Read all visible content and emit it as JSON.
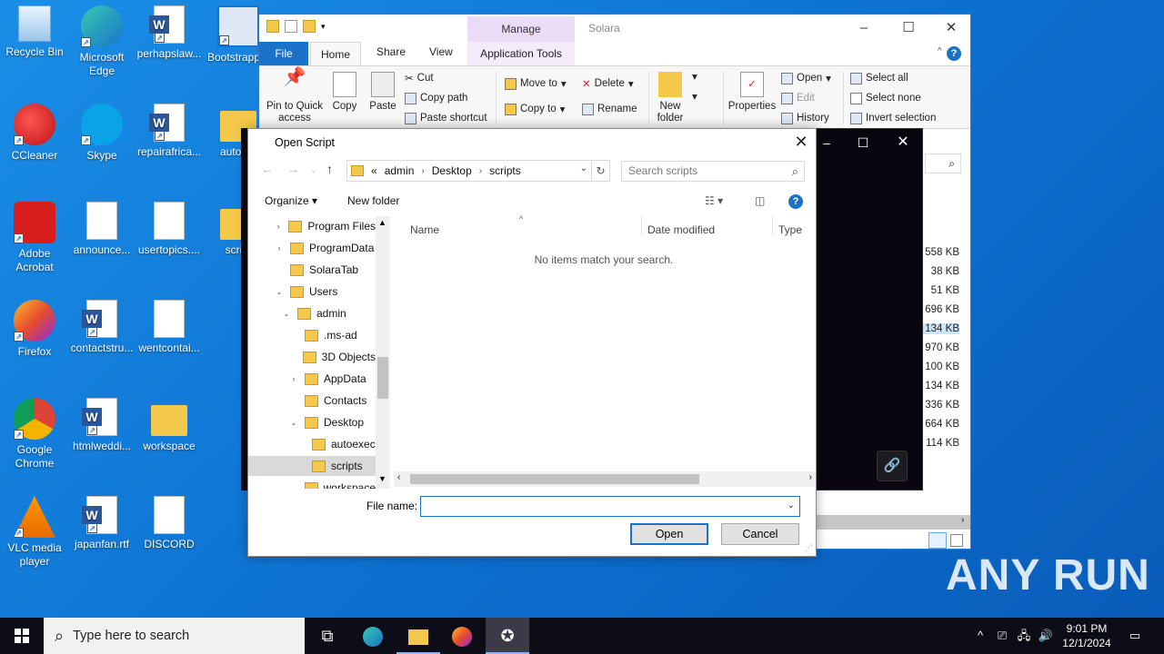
{
  "desktop": {
    "icons": [
      {
        "label": "Recycle Bin",
        "icon": "recycle-bin-icon"
      },
      {
        "label": "Microsoft Edge",
        "icon": "edge-icon"
      },
      {
        "label": "perhapslaw...",
        "icon": "word-document-icon"
      },
      {
        "label": "Bootstrapp...",
        "icon": "installer-icon"
      },
      {
        "label": "CCleaner",
        "icon": "ccleaner-icon"
      },
      {
        "label": "Skype",
        "icon": "skype-icon"
      },
      {
        "label": "repairafrica...",
        "icon": "word-document-icon"
      },
      {
        "label": "autoe...",
        "icon": "folder-icon"
      },
      {
        "label": "Adobe Acrobat",
        "icon": "acrobat-icon"
      },
      {
        "label": "announce...",
        "icon": "image-file-icon"
      },
      {
        "label": "usertopics....",
        "icon": "image-file-icon"
      },
      {
        "label": "scri...",
        "icon": "folder-icon"
      },
      {
        "label": "Firefox",
        "icon": "firefox-icon"
      },
      {
        "label": "contactstru...",
        "icon": "word-document-icon"
      },
      {
        "label": "wentcontai...",
        "icon": "image-file-icon"
      },
      {
        "label": "Google Chrome",
        "icon": "chrome-icon"
      },
      {
        "label": "htmlweddi...",
        "icon": "word-document-icon"
      },
      {
        "label": "workspace",
        "icon": "folder-icon"
      },
      {
        "label": "VLC media player",
        "icon": "vlc-icon"
      },
      {
        "label": "japanfan.rtf",
        "icon": "word-document-icon"
      },
      {
        "label": "DISCORD",
        "icon": "blank-file-icon"
      }
    ]
  },
  "explorer": {
    "title": "Solara",
    "manage_tab": "Manage",
    "tabs": {
      "file": "File",
      "home": "Home",
      "share": "Share",
      "view": "View",
      "app_tools": "Application Tools"
    },
    "ribbon": {
      "pin": "Pin to Quick access",
      "copy": "Copy",
      "paste": "Paste",
      "cut": "Cut",
      "copy_path": "Copy path",
      "paste_shortcut": "Paste shortcut",
      "move_to": "Move to",
      "copy_to": "Copy to",
      "delete": "Delete",
      "rename": "Rename",
      "new_folder": "New folder",
      "properties": "Properties",
      "open": "Open",
      "edit": "Edit",
      "history": "History",
      "select_all": "Select all",
      "select_none": "Select none",
      "invert_selection": "Invert selection"
    },
    "sizes": [
      "558 KB",
      "38 KB",
      "51 KB",
      "696 KB",
      "134 KB",
      "970 KB",
      "100 KB",
      "134 KB",
      "336 KB",
      "664 KB",
      "114 KB"
    ],
    "selected_size_index": 4
  },
  "dialog": {
    "title": "Open Script",
    "address": {
      "prefix": "«",
      "crumbs": [
        "admin",
        "Desktop",
        "scripts"
      ]
    },
    "search_placeholder": "Search scripts",
    "organize": "Organize",
    "new_folder": "New folder",
    "tree": [
      {
        "label": "Program Files",
        "indent": 0,
        "chevron": "›"
      },
      {
        "label": "ProgramData",
        "indent": 0,
        "chevron": "›"
      },
      {
        "label": "SolaraTab",
        "indent": 0,
        "chevron": ""
      },
      {
        "label": "Users",
        "indent": 0,
        "chevron": "⌄"
      },
      {
        "label": "admin",
        "indent": 1,
        "chevron": "⌄"
      },
      {
        "label": ".ms-ad",
        "indent": 2,
        "chevron": ""
      },
      {
        "label": "3D Objects",
        "indent": 2,
        "chevron": ""
      },
      {
        "label": "AppData",
        "indent": 2,
        "chevron": "›"
      },
      {
        "label": "Contacts",
        "indent": 2,
        "chevron": ""
      },
      {
        "label": "Desktop",
        "indent": 2,
        "chevron": "⌄"
      },
      {
        "label": "autoexec",
        "indent": 3,
        "chevron": ""
      },
      {
        "label": "scripts",
        "indent": 3,
        "chevron": "",
        "selected": true
      },
      {
        "label": "workspace",
        "indent": 3,
        "chevron": ""
      }
    ],
    "columns": {
      "name": "Name",
      "date": "Date modified",
      "type": "Type"
    },
    "empty_message": "No items match your search.",
    "file_name_label": "File name:",
    "file_name_value": "",
    "open_button": "Open",
    "cancel_button": "Cancel"
  },
  "taskbar": {
    "search_placeholder": "Type here to search",
    "time": "9:01 PM",
    "date": "12/1/2024"
  },
  "watermark": "ANY RUN"
}
